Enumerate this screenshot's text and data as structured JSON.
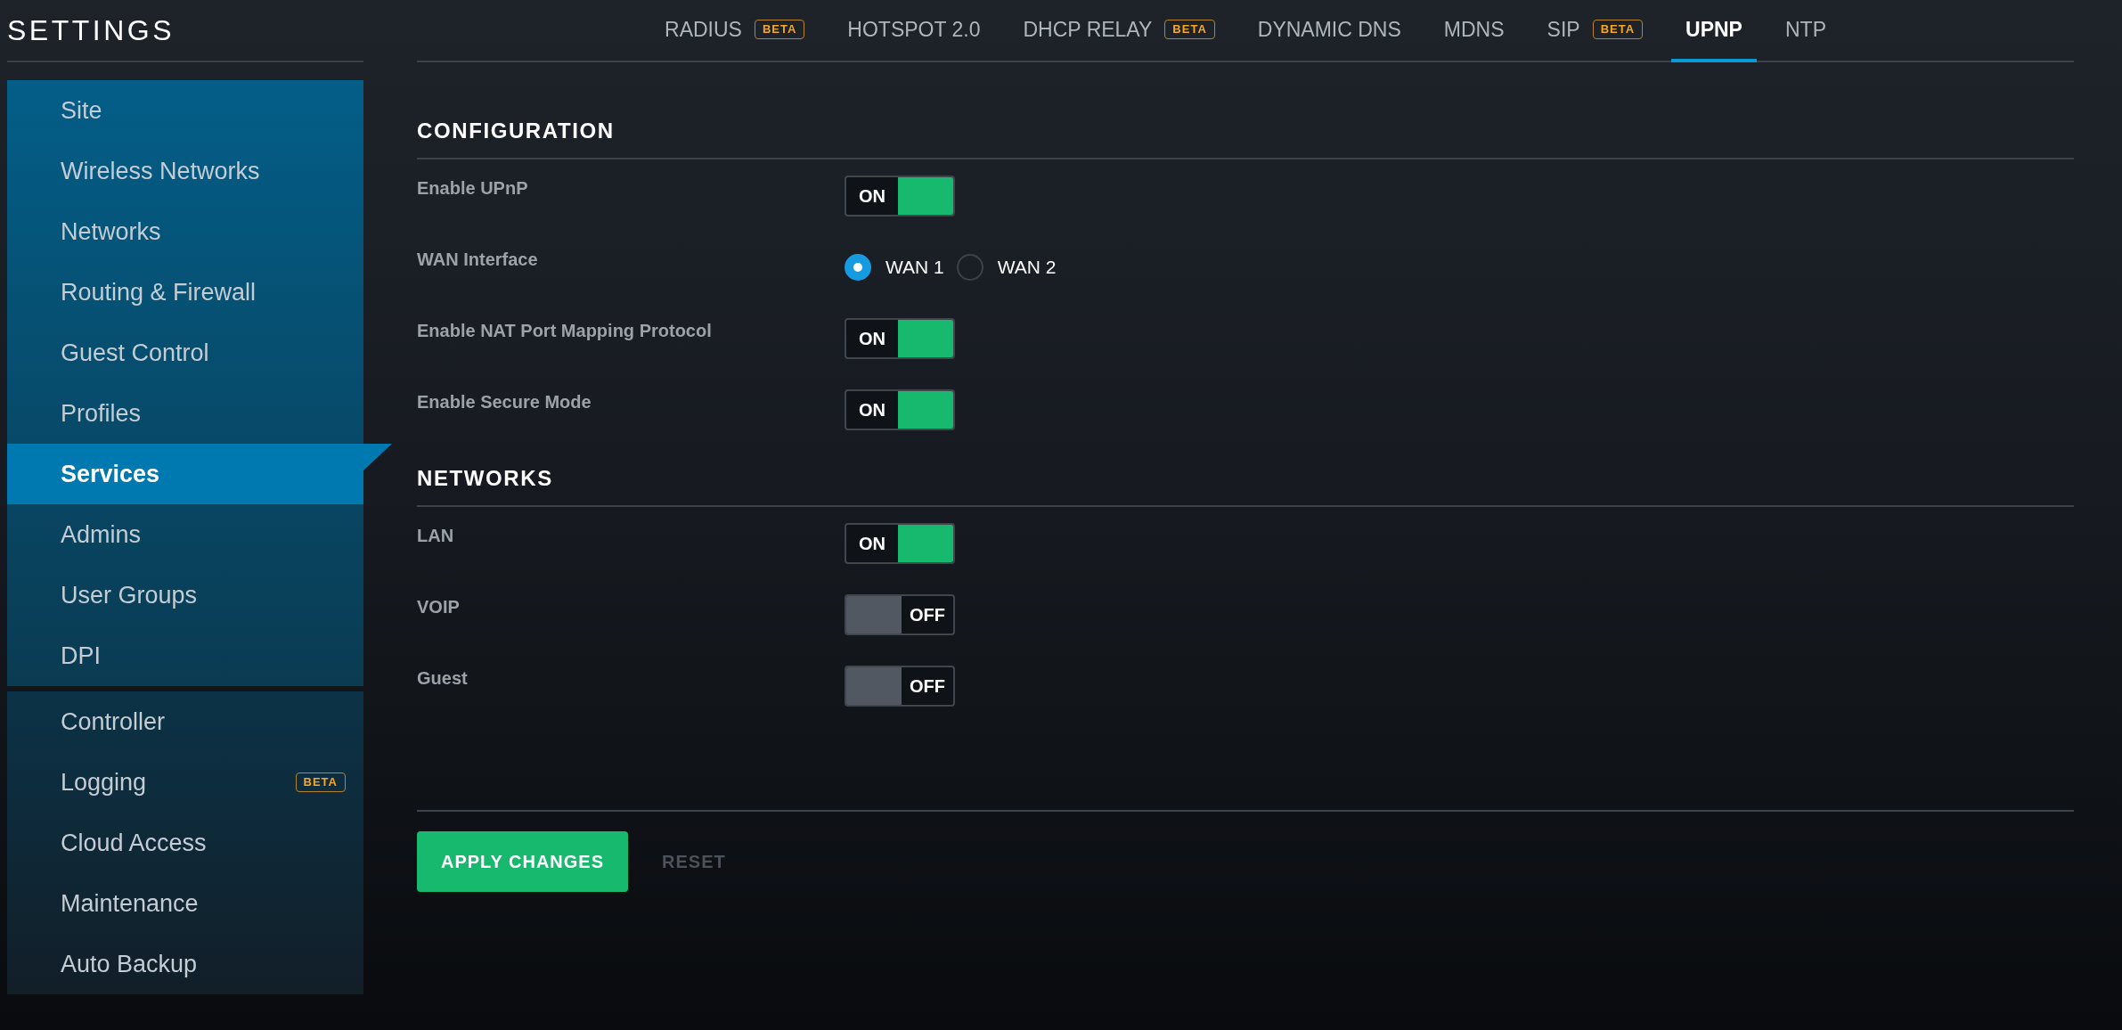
{
  "sidebar": {
    "title": "SETTINGS",
    "groups": [
      {
        "items": [
          {
            "label": "Site",
            "selected": false
          },
          {
            "label": "Wireless Networks",
            "selected": false
          },
          {
            "label": "Networks",
            "selected": false
          },
          {
            "label": "Routing & Firewall",
            "selected": false
          },
          {
            "label": "Guest Control",
            "selected": false
          },
          {
            "label": "Profiles",
            "selected": false
          },
          {
            "label": "Services",
            "selected": true
          },
          {
            "label": "Admins",
            "selected": false
          },
          {
            "label": "User Groups",
            "selected": false
          },
          {
            "label": "DPI",
            "selected": false
          }
        ]
      },
      {
        "items": [
          {
            "label": "Controller",
            "selected": false
          },
          {
            "label": "Logging",
            "badge": "BETA",
            "selected": false
          },
          {
            "label": "Cloud Access",
            "selected": false
          },
          {
            "label": "Maintenance",
            "selected": false
          },
          {
            "label": "Auto Backup",
            "selected": false
          }
        ]
      }
    ]
  },
  "tabs": [
    {
      "label": "RADIUS",
      "badge": "BETA",
      "selected": false
    },
    {
      "label": "HOTSPOT 2.0",
      "selected": false
    },
    {
      "label": "DHCP RELAY",
      "badge": "BETA",
      "selected": false
    },
    {
      "label": "DYNAMIC DNS",
      "selected": false
    },
    {
      "label": "MDNS",
      "selected": false
    },
    {
      "label": "SIP",
      "badge": "BETA",
      "selected": false
    },
    {
      "label": "UPNP",
      "selected": true
    },
    {
      "label": "NTP",
      "selected": false
    }
  ],
  "sections": [
    {
      "heading": "CONFIGURATION",
      "rows": [
        {
          "label": "Enable UPnP",
          "kind": "toggle",
          "on": true,
          "text": "ON"
        },
        {
          "label": "WAN Interface",
          "kind": "radio",
          "options": [
            {
              "label": "WAN 1",
              "selected": true
            },
            {
              "label": "WAN 2",
              "selected": false
            }
          ]
        },
        {
          "label": "Enable NAT Port Mapping Protocol",
          "kind": "toggle",
          "on": true,
          "text": "ON"
        },
        {
          "label": "Enable Secure Mode",
          "kind": "toggle",
          "on": true,
          "text": "ON"
        }
      ]
    },
    {
      "heading": "NETWORKS",
      "rows": [
        {
          "label": "LAN",
          "kind": "toggle",
          "on": true,
          "text": "ON"
        },
        {
          "label": "VOIP",
          "kind": "toggle",
          "on": false,
          "text": "OFF"
        },
        {
          "label": "Guest",
          "kind": "toggle",
          "on": false,
          "text": "OFF"
        }
      ]
    }
  ],
  "actions": {
    "apply": "APPLY CHANGES",
    "reset": {
      "label": "RESET",
      "disabled": true
    }
  }
}
